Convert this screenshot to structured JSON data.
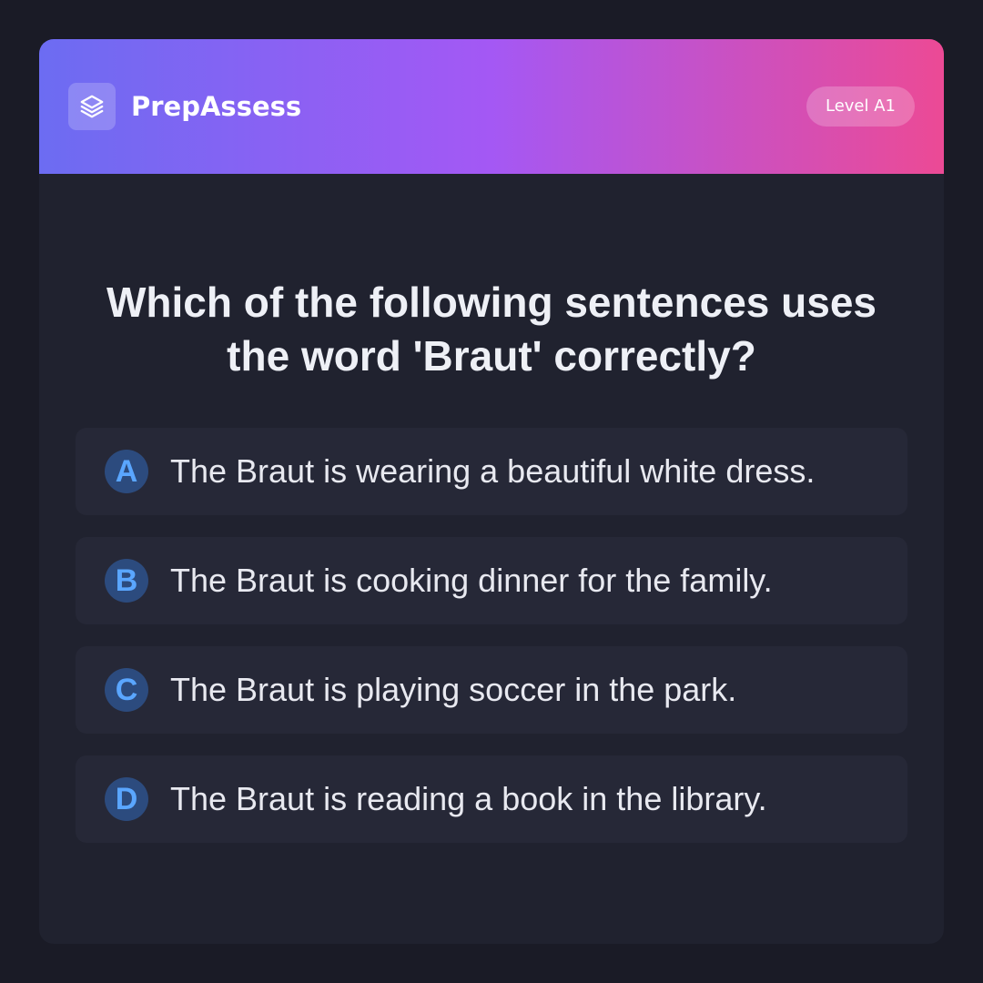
{
  "header": {
    "brand": "PrepAssess",
    "level_badge": "Level A1",
    "logo_icon": "layers-icon"
  },
  "question": {
    "text": "Which of the following sentences uses the word 'Braut' correctly?"
  },
  "options": [
    {
      "letter": "A",
      "text": "The Braut is wearing a beautiful white dress."
    },
    {
      "letter": "B",
      "text": "The Braut is cooking dinner for the family."
    },
    {
      "letter": "C",
      "text": "The Braut is playing soccer in the park."
    },
    {
      "letter": "D",
      "text": "The Braut is reading a book in the library."
    }
  ],
  "colors": {
    "background": "#1a1b26",
    "card": "#20222f",
    "gradient_start": "#6c6cf2",
    "gradient_mid": "#a458f4",
    "gradient_end": "#ec4a95",
    "option_bg": "#262837",
    "letter_circle": "#2c4b7e",
    "letter_text": "#5aa6ff"
  }
}
